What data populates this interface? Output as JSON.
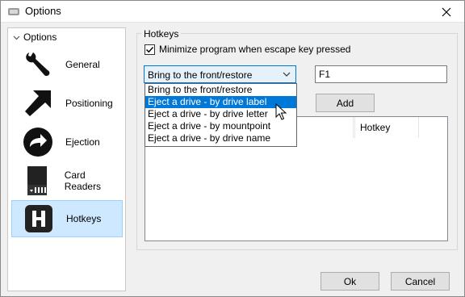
{
  "window": {
    "title": "Options",
    "icon": "app-drive-icon",
    "close_icon": "close-icon"
  },
  "sidebar": {
    "header": "Options",
    "items": [
      {
        "label": "General",
        "icon": "wrench-icon"
      },
      {
        "label": "Positioning",
        "icon": "arrow-icon"
      },
      {
        "label": "Ejection",
        "icon": "eject-arrow-icon"
      },
      {
        "label": "Card Readers",
        "icon": "sd-card-icon"
      },
      {
        "label": "Hotkeys",
        "icon": "hotkey-h-icon",
        "selected": true
      }
    ]
  },
  "hotkeys": {
    "group_title": "Hotkeys",
    "minimize_label": "Minimize program when escape key pressed",
    "minimize_checked": true,
    "action_selected": "Bring to the front/restore",
    "hotkey_value": "F1",
    "add_label": "Add",
    "dropdown_options": [
      "Bring to the front/restore",
      "Eject a drive - by drive label",
      "Eject a drive - by drive letter",
      "Eject a drive - by mountpoint",
      "Eject a drive - by drive name"
    ],
    "highlighted_option": "Eject a drive - by drive label",
    "list_columns": [
      "",
      "Hotkey"
    ]
  },
  "footer": {
    "ok_label": "Ok",
    "cancel_label": "Cancel"
  },
  "colors": {
    "accent": "#0078d7",
    "selection_bg": "#cde8ff",
    "window_bg": "#f0f0f0"
  }
}
